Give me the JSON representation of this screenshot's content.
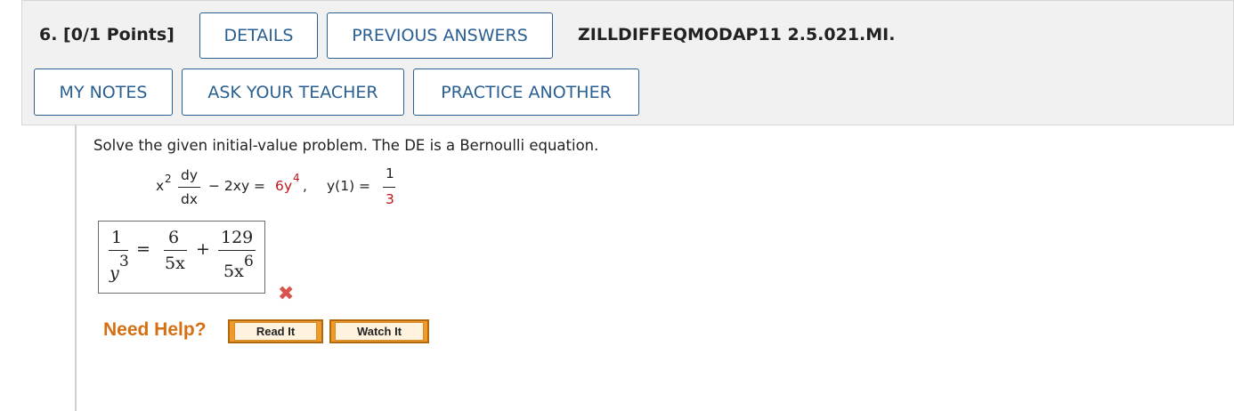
{
  "question": {
    "number_label": "6. [0/1 Points]",
    "code": "ZILLDIFFEQMODAP11 2.5.021.MI."
  },
  "buttons": {
    "details": "DETAILS",
    "previous_answers": "PREVIOUS ANSWERS",
    "my_notes": "MY NOTES",
    "ask_teacher": "ASK YOUR TEACHER",
    "practice_another": "PRACTICE ANOTHER"
  },
  "problem": {
    "prompt": "Solve the given initial-value problem. The DE is a Bernoulli equation.",
    "equation": {
      "x": "x",
      "x_exp": "2",
      "dy": "dy",
      "dx": "dx",
      "middle": "− 2xy =",
      "rhs_coef": "6",
      "rhs_var": "y",
      "rhs_exp": "4",
      "comma": ",",
      "ic_lhs": "y(1) =",
      "ic_num": "1",
      "ic_den": "3"
    }
  },
  "answer": {
    "lhs_num": "1",
    "lhs_den_var": "y",
    "lhs_den_exp": "3",
    "equals": "=",
    "t1_num": "6",
    "t1_den": "5x",
    "plus": "+",
    "t2_num": "129",
    "t2_den_base": "5x",
    "t2_den_exp": "6",
    "status": "incorrect",
    "status_mark": "✖"
  },
  "help": {
    "label": "Need Help?",
    "read_it": "Read It",
    "watch_it": "Watch It"
  },
  "colors": {
    "button_border": "#2a5f91",
    "incorrect_red": "#c0141d",
    "help_orange": "#d56f12"
  }
}
